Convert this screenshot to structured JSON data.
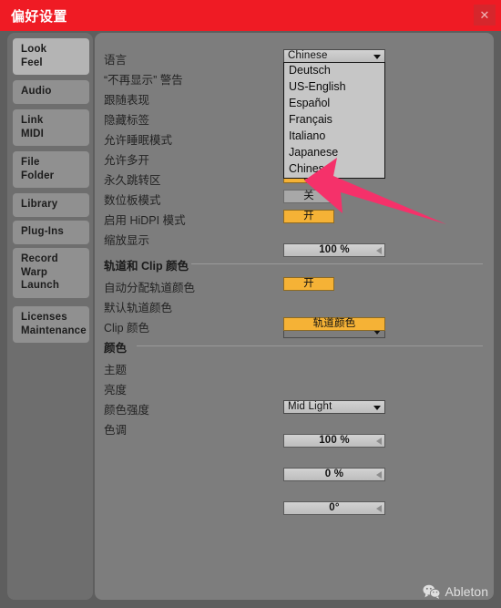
{
  "window": {
    "title": "偏好设置",
    "close_icon": "close-icon",
    "accent_red": "#ef1b24",
    "panel_bg": "#7d7d7d",
    "sidebar_bg": "#6e6e6e",
    "arrow_color": "#f5316a",
    "toggle_on_color": "#f5b236"
  },
  "sidebar": {
    "items": [
      {
        "lines": [
          "Look",
          "Feel"
        ],
        "active": true
      },
      {
        "lines": [
          "Audio"
        ],
        "active": false
      },
      {
        "lines": [
          "Link",
          "MIDI"
        ],
        "active": false
      },
      {
        "lines": [
          "File",
          "Folder"
        ],
        "active": false
      },
      {
        "lines": [
          "Library"
        ],
        "active": false
      },
      {
        "lines": [
          "Plug-Ins"
        ],
        "active": false
      },
      {
        "lines": [
          "Record",
          "Warp",
          "Launch"
        ],
        "active": false
      },
      {
        "lines": [
          "Licenses",
          "Maintenance"
        ],
        "active": false
      }
    ]
  },
  "main": {
    "rows": [
      {
        "label": "语言",
        "control": "dropdown",
        "value": "Chinese"
      },
      {
        "label": "“不再显示” 警告",
        "control": "none",
        "value": ""
      },
      {
        "label": "跟随表现",
        "control": "none",
        "value": ""
      },
      {
        "label": "隐藏标签",
        "control": "none",
        "value": ""
      },
      {
        "label": "允许睡眠模式",
        "control": "none",
        "value": ""
      },
      {
        "label": "允许多开",
        "control": "none",
        "value": ""
      },
      {
        "label": "永久跳转区",
        "control": "toggle-on",
        "value": "开"
      },
      {
        "label": "数位板模式",
        "control": "toggle-off",
        "value": "关"
      },
      {
        "label": "启用 HiDPI 模式",
        "control": "toggle-on",
        "value": "开"
      },
      {
        "label": "缩放显示",
        "control": "slider",
        "value": "100 %"
      }
    ],
    "section_track_clip": {
      "title": "轨道和 Clip 颜色",
      "rows": [
        {
          "label": "自动分配轨道颜色",
          "control": "toggle-on",
          "value": "开"
        },
        {
          "label": "默认轨道颜色",
          "control": "dropdown-blank",
          "value": ""
        },
        {
          "label": "Clip 颜色",
          "control": "colorbtn",
          "value": "轨道颜色"
        }
      ]
    },
    "section_color": {
      "title": "颜色",
      "rows": [
        {
          "label": "主题",
          "control": "dropdown",
          "value": "Mid Light"
        },
        {
          "label": "亮度",
          "control": "slider",
          "value": "100 %"
        },
        {
          "label": "颜色强度",
          "control": "slider",
          "value": "0 %"
        },
        {
          "label": "色调",
          "control": "slider",
          "value": "0°"
        }
      ]
    }
  },
  "language_dropdown": {
    "open": true,
    "selected": "Chinese",
    "options": [
      "Deutsch",
      "US-English",
      "Español",
      "Français",
      "Italiano",
      "Japanese",
      "Chinese"
    ]
  },
  "watermark": {
    "icon": "wechat-icon",
    "text": "Ableton"
  }
}
